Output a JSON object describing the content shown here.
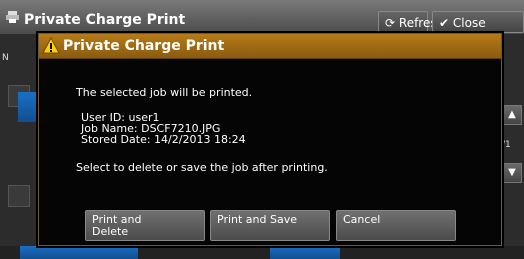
{
  "background": {
    "title": "Private Charge Print",
    "refresh_label": "Refresh",
    "close_label": "Close",
    "page_indicator": "/1",
    "side_label": "N"
  },
  "dialog": {
    "title": "Private Charge Print",
    "message": "The selected job will be printed.",
    "details": {
      "user_id": "User ID: user1",
      "job_name": "Job Name: DSCF7210.JPG",
      "stored_date": "Stored Date: 14/2/2013 18:24"
    },
    "prompt": "Select to delete or save the job after printing.",
    "buttons": [
      {
        "label": "Print and\nDelete"
      },
      {
        "label": "Print and Save"
      },
      {
        "label": "Cancel"
      }
    ]
  },
  "colors": {
    "header_amber": "#b67b17",
    "dialog_bg": "#050505",
    "accent_blue": "#1b6fc6"
  },
  "icons": {
    "warning": "warning-icon",
    "printer": "printer-icon",
    "refresh": "refresh-icon",
    "close": "close-icon",
    "scroll_up": "scroll-up-icon",
    "scroll_down": "scroll-down-icon"
  }
}
